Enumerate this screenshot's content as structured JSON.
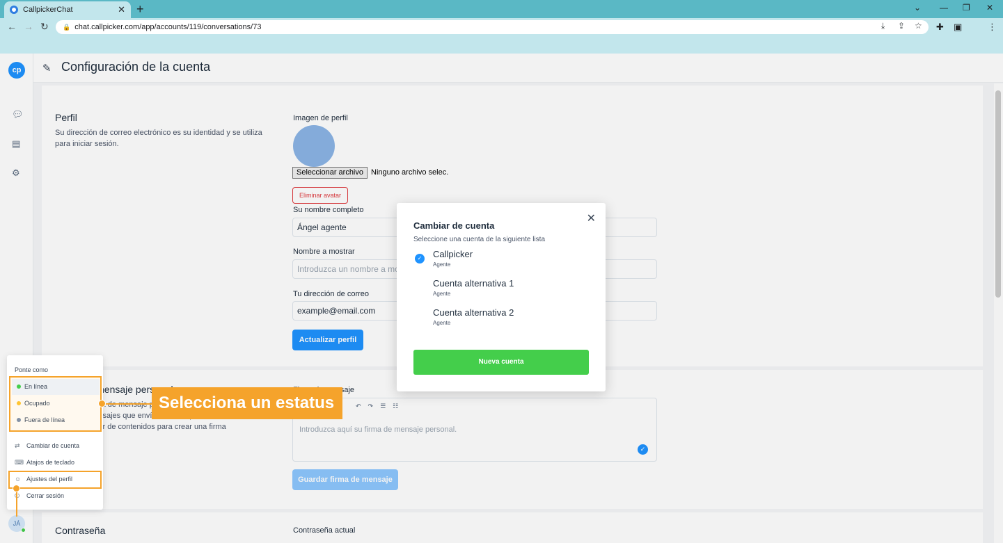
{
  "browser": {
    "tab_title": "CallpickerChat",
    "tab_close": "✕",
    "new_tab": "+",
    "url": "chat.callpicker.com/app/accounts/119/conversations/73"
  },
  "app": {
    "logo_text": "cp",
    "page_title": "Configuración de la cuenta",
    "user_initials": "JÁ"
  },
  "profile": {
    "title": "Perfil",
    "description": "Su dirección de correo electrónico es su identidad y se utiliza para iniciar sesión.",
    "image_label": "Imagen de perfil",
    "file_button": "Seleccionar archivo",
    "file_none": "Ninguno archivo selec.",
    "remove_avatar": "Eliminar avatar",
    "full_name_label": "Su nombre completo",
    "full_name_value": "Ángel agente",
    "display_name_label": "Nombre a mostrar",
    "display_name_placeholder": "Introduzca un nombre a mostrar, este se mostrará en las conversaciones",
    "email_label": "Tu dirección de correo",
    "email_value": "example@email.com",
    "update_button": "Actualizar perfil"
  },
  "signature": {
    "title": "Firma de mensaje personal",
    "description": "Cree una firma de mensaje personal que se agregará a todos los mensajes que envíe desde la plataforma. Utilice el editor de contenidos para crear una firma altamente",
    "label": "Firma de mensaje",
    "placeholder": "Introduzca aquí su firma de mensaje personal.",
    "save_button": "Guardar firma de mensaje"
  },
  "password": {
    "title": "Contraseña",
    "current_label": "Contraseña actual"
  },
  "modal": {
    "title": "Cambiar de cuenta",
    "subtitle": "Seleccione una cuenta de la siguiente lista",
    "accounts": [
      {
        "name": "Callpicker",
        "role": "Agente",
        "selected": true
      },
      {
        "name": "Cuenta alternativa 1",
        "role": "Agente",
        "selected": false
      },
      {
        "name": "Cuenta alternativa 2",
        "role": "Agente",
        "selected": false
      }
    ],
    "new_account_button": "Nueva cuenta"
  },
  "menu": {
    "header": "Ponte como",
    "statuses": [
      {
        "label": "En línea",
        "color": "#44ce4b"
      },
      {
        "label": "Ocupado",
        "color": "#ffc532"
      },
      {
        "label": "Fuera de línea",
        "color": "#8492a6"
      }
    ],
    "items": [
      {
        "label": "Cambiar de cuenta",
        "icon": "switch-icon"
      },
      {
        "label": "Atajos de teclado",
        "icon": "keyboard-icon"
      },
      {
        "label": "Ajustes del perfil",
        "icon": "person-icon"
      },
      {
        "label": "Cerrar sesión",
        "icon": "logout-icon"
      }
    ]
  },
  "annotation": {
    "text": "Selecciona un estatus"
  },
  "colors": {
    "accent": "#1f93ff",
    "success": "#44ce4b",
    "annotation": "#f5a32b",
    "browser_tabbar": "#5ab8c5"
  }
}
